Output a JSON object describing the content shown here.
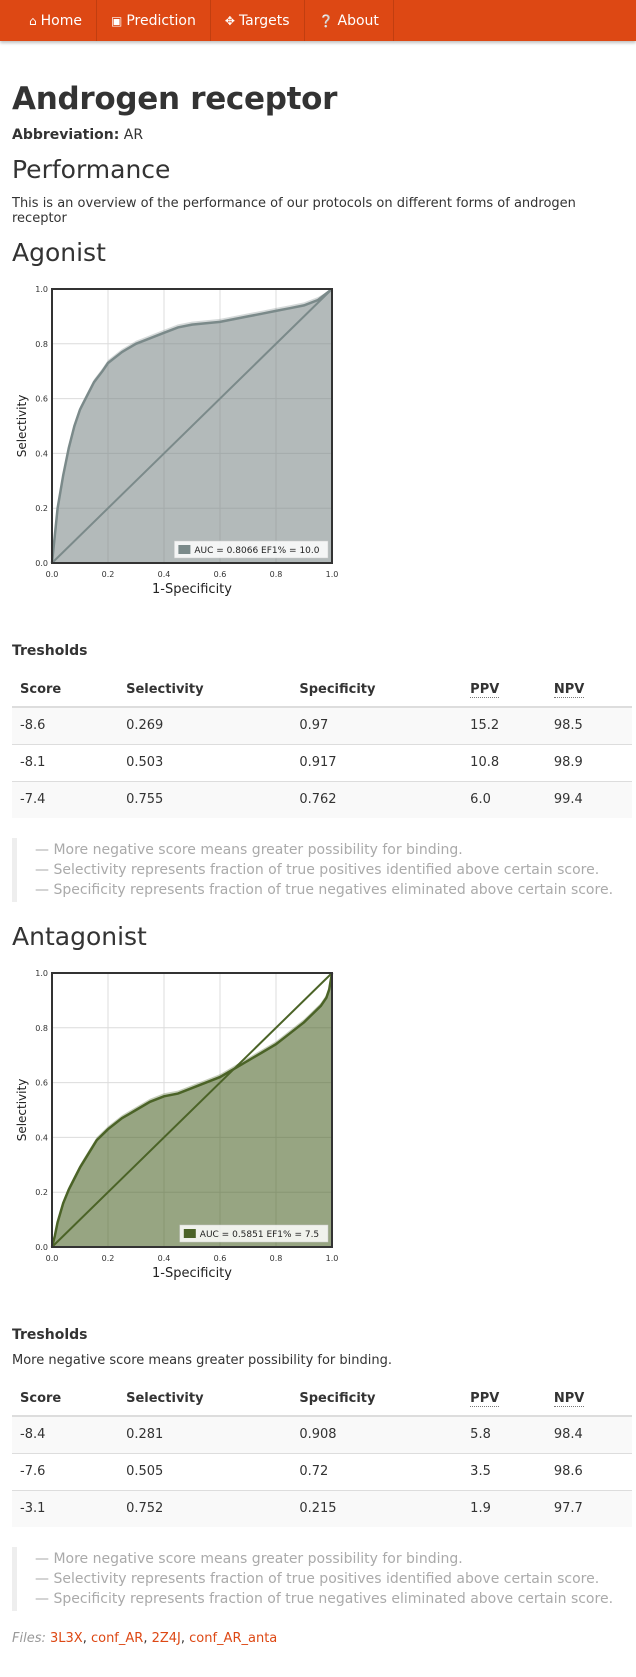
{
  "nav": [
    {
      "label": "Home",
      "icon": "home-icon"
    },
    {
      "label": "Prediction",
      "icon": "camera-icon"
    },
    {
      "label": "Targets",
      "icon": "crosshair-icon"
    },
    {
      "label": "About",
      "icon": "question-circle-icon"
    }
  ],
  "page": {
    "title": "Androgen receptor",
    "abbreviation_label": "Abbreviation:",
    "abbreviation_value": "AR",
    "performance_heading": "Performance",
    "overview": "This is an overview of the performance of our protocols on different forms of androgen receptor"
  },
  "colors": {
    "accent": "#dd4814",
    "agonist": "#7b8a8a",
    "antagonist": "#4b6327"
  },
  "agonist": {
    "heading": "Agonist",
    "thresholds_title": "Tresholds",
    "headers": [
      "Score",
      "Selectivity",
      "Specificity",
      "PPV",
      "NPV"
    ],
    "rows": [
      [
        "-8.6",
        "0.269",
        "0.97",
        "15.2",
        "98.5"
      ],
      [
        "-8.1",
        "0.503",
        "0.917",
        "10.8",
        "98.9"
      ],
      [
        "-7.4",
        "0.755",
        "0.762",
        "6.0",
        "99.4"
      ]
    ],
    "notes": [
      "— More negative score means greater possibility for binding.",
      "— Selectivity represents fraction of true positives identified above certain score.",
      "— Specificity represents fraction of true negatives eliminated above certain score."
    ]
  },
  "antagonist": {
    "heading": "Antagonist",
    "thresholds_title": "Tresholds",
    "thresholds_desc": "More negative score means greater possibility for binding.",
    "headers": [
      "Score",
      "Selectivity",
      "Specificity",
      "PPV",
      "NPV"
    ],
    "rows": [
      [
        "-8.4",
        "0.281",
        "0.908",
        "5.8",
        "98.4"
      ],
      [
        "-7.6",
        "0.505",
        "0.72",
        "3.5",
        "98.6"
      ],
      [
        "-3.1",
        "0.752",
        "0.215",
        "1.9",
        "97.7"
      ]
    ],
    "notes": [
      "— More negative score means greater possibility for binding.",
      "— Selectivity represents fraction of true positives identified above certain score.",
      "— Specificity represents fraction of true negatives eliminated above certain score."
    ]
  },
  "files": {
    "label": "Files:",
    "links": [
      "3L3X",
      "conf_AR",
      "2Z4J",
      "conf_AR_anta"
    ]
  },
  "chart_data": [
    {
      "type": "area",
      "xlabel": "1-Specificity",
      "ylabel": "Selectivity",
      "xlim": [
        0,
        1
      ],
      "ylim": [
        0,
        1
      ],
      "ticks": [
        "0.0",
        "0.2",
        "0.4",
        "0.6",
        "0.8",
        "1.0"
      ],
      "grid": true,
      "legend_position": "bottom-right",
      "legend": "AUC = 0.8066 EF1% = 10.0",
      "diagonal": true,
      "color": "#7b8a8a",
      "series": [
        {
          "x": [
            0,
            0.01,
            0.02,
            0.04,
            0.06,
            0.08,
            0.1,
            0.12,
            0.15,
            0.18,
            0.2,
            0.25,
            0.3,
            0.35,
            0.4,
            0.45,
            0.5,
            0.55,
            0.6,
            0.65,
            0.7,
            0.75,
            0.8,
            0.85,
            0.9,
            0.95,
            1.0
          ],
          "y": [
            0,
            0.1,
            0.2,
            0.32,
            0.42,
            0.5,
            0.56,
            0.6,
            0.66,
            0.7,
            0.73,
            0.77,
            0.8,
            0.82,
            0.84,
            0.86,
            0.87,
            0.875,
            0.88,
            0.89,
            0.9,
            0.91,
            0.92,
            0.93,
            0.94,
            0.96,
            1.0
          ]
        }
      ]
    },
    {
      "type": "area",
      "xlabel": "1-Specificity",
      "ylabel": "Selectivity",
      "xlim": [
        0,
        1
      ],
      "ylim": [
        0,
        1
      ],
      "ticks": [
        "0.0",
        "0.2",
        "0.4",
        "0.6",
        "0.8",
        "1.0"
      ],
      "grid": true,
      "legend_position": "bottom-right",
      "legend": "AUC = 0.5851 EF1% = 7.5",
      "diagonal": true,
      "color": "#4b6327",
      "series": [
        {
          "x": [
            0,
            0.01,
            0.02,
            0.04,
            0.06,
            0.08,
            0.1,
            0.13,
            0.16,
            0.2,
            0.25,
            0.3,
            0.35,
            0.4,
            0.45,
            0.5,
            0.55,
            0.6,
            0.65,
            0.7,
            0.75,
            0.8,
            0.85,
            0.9,
            0.93,
            0.96,
            0.98,
            0.99,
            1.0
          ],
          "y": [
            0,
            0.04,
            0.09,
            0.16,
            0.21,
            0.25,
            0.29,
            0.34,
            0.39,
            0.43,
            0.47,
            0.5,
            0.53,
            0.55,
            0.56,
            0.58,
            0.6,
            0.62,
            0.65,
            0.68,
            0.71,
            0.74,
            0.78,
            0.82,
            0.85,
            0.88,
            0.91,
            0.94,
            1.0
          ]
        }
      ]
    }
  ]
}
